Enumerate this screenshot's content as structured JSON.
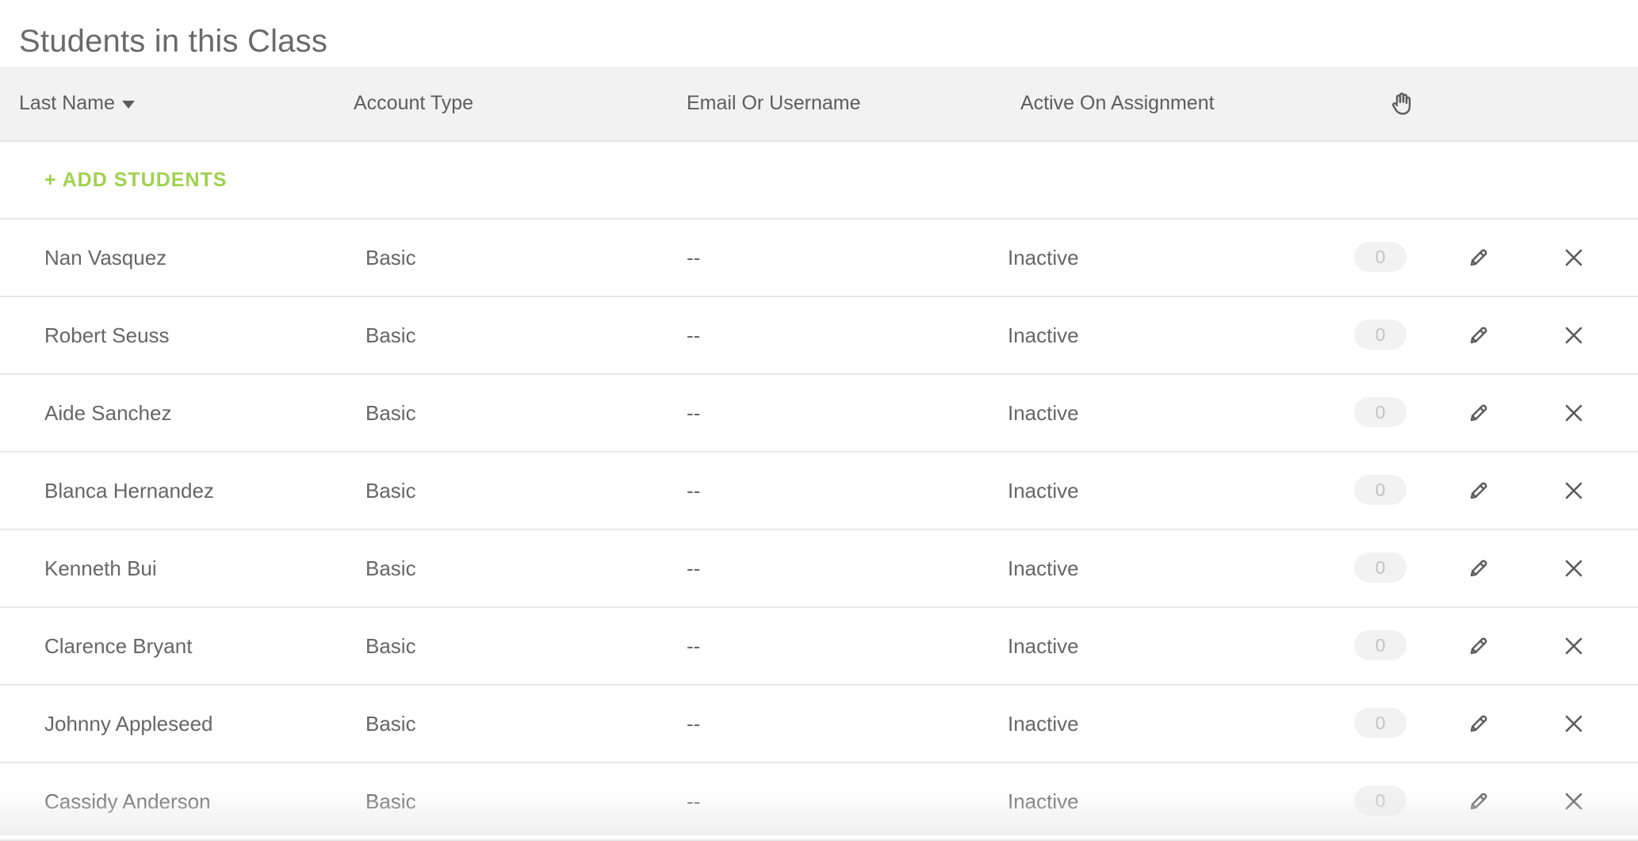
{
  "page": {
    "title": "Students in this Class"
  },
  "table": {
    "headers": {
      "last_name": "Last Name",
      "account_type": "Account Type",
      "email_or_username": "Email Or Username",
      "active_on_assignment": "Active On Assignment",
      "hand_raise_icon": "hand-raise-icon"
    },
    "sort": {
      "column": "last_name",
      "direction": "descending"
    },
    "add_students_label": "+ ADD STUDENTS",
    "rows": [
      {
        "name": "Nan Vasquez",
        "account_type": "Basic",
        "email": "--",
        "status": "Inactive",
        "hand_raises": "0"
      },
      {
        "name": "Robert Seuss",
        "account_type": "Basic",
        "email": "--",
        "status": "Inactive",
        "hand_raises": "0"
      },
      {
        "name": "Aide Sanchez",
        "account_type": "Basic",
        "email": "--",
        "status": "Inactive",
        "hand_raises": "0"
      },
      {
        "name": "Blanca Hernandez",
        "account_type": "Basic",
        "email": "--",
        "status": "Inactive",
        "hand_raises": "0"
      },
      {
        "name": "Kenneth Bui",
        "account_type": "Basic",
        "email": "--",
        "status": "Inactive",
        "hand_raises": "0"
      },
      {
        "name": "Clarence Bryant",
        "account_type": "Basic",
        "email": "--",
        "status": "Inactive",
        "hand_raises": "0"
      },
      {
        "name": "Johnny Appleseed",
        "account_type": "Basic",
        "email": "--",
        "status": "Inactive",
        "hand_raises": "0"
      },
      {
        "name": "Cassidy Anderson",
        "account_type": "Basic",
        "email": "--",
        "status": "Inactive",
        "hand_raises": "0"
      }
    ]
  },
  "colors": {
    "accent_green": "#9fd24d",
    "header_bg": "#f2f2f2",
    "text": "#666666",
    "badge_bg": "#f2f2f2",
    "badge_text": "#c2c2c2"
  },
  "icons": {
    "edit": "pencil-icon",
    "remove": "close-icon",
    "sort": "caret-down-icon"
  }
}
